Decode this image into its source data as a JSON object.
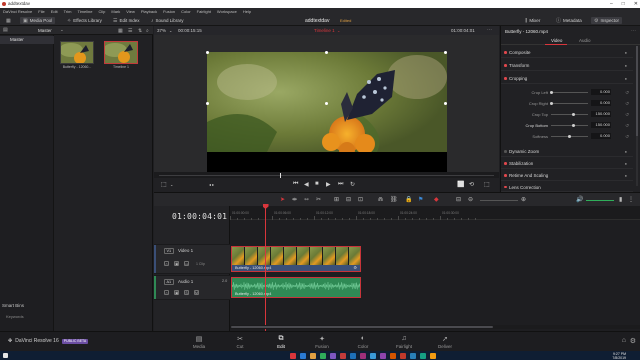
{
  "window": {
    "os_title": "addtextdav",
    "controls": [
      "–",
      "□",
      "✕"
    ]
  },
  "menu": [
    "DaVinci Resolve",
    "File",
    "Edit",
    "Trim",
    "Timeline",
    "Clip",
    "Mark",
    "View",
    "Playback",
    "Fusion",
    "Color",
    "Fairlight",
    "Workspace",
    "Help"
  ],
  "toolbar": {
    "media_pool": "Media Pool",
    "effects_library": "Effects Library",
    "edit_index": "Edit Index",
    "sound_library": "Sound Library",
    "project_name": "addtextdav",
    "project_status": "Edited",
    "mixer": "Mixer",
    "metadata": "Metadata",
    "inspector": "Inspector"
  },
  "media_pool": {
    "header_label": "Master",
    "bins": [
      "Master"
    ],
    "smart_bins": "Smart Bins",
    "keywords": "Keywords",
    "clips": [
      {
        "name": "Butterfly - 12060...",
        "selected": false
      },
      {
        "name": "Timeline 1",
        "selected": true
      }
    ]
  },
  "viewer": {
    "zoom": "37%",
    "timecode_left": "00:00:15:15",
    "timeline_name": "Timeline 1",
    "timecode_right": "01:00:04:01",
    "playback_position": 0.36
  },
  "inspector": {
    "title": "Butterfly - 12060.mp4",
    "tabs": [
      "Video",
      "Audio"
    ],
    "active_tab": "Video",
    "sections_top": [
      "Composite",
      "Transform",
      "Cropping"
    ],
    "crop_params": [
      {
        "label": "Crop Left",
        "value": "0.000",
        "bright": false,
        "level": 0.0
      },
      {
        "label": "Crop Right",
        "value": "0.000",
        "bright": false,
        "level": 0.0
      },
      {
        "label": "Crop Top",
        "value": "150.000",
        "bright": false,
        "level": 0.62
      },
      {
        "label": "Crop Bottom",
        "value": "150.000",
        "bright": true,
        "level": 0.62
      },
      {
        "label": "Softness",
        "value": "0.000",
        "bright": false,
        "level": 0.5
      }
    ],
    "sections_bottom": [
      "Dynamic Zoom",
      "Stabilization",
      "Retime And Scaling",
      "Lens Correction"
    ]
  },
  "timeline": {
    "timecode": "01:00:04:01",
    "ruler_ticks": [
      "01:00:00:00",
      "01:00:06:00",
      "01:00:12:00",
      "01:00:18:00",
      "01:00:24:00",
      "01:00:30:00"
    ],
    "tracks": [
      {
        "id": "V1",
        "name": "Video 1",
        "clip_count": "1 Clip",
        "clip_label": "Butterfly - 12060.mp4"
      },
      {
        "id": "A1",
        "name": "Audio 1",
        "level": "2.0",
        "clip_label": "Butterfly - 12060.mp4"
      }
    ],
    "audio_buttons": [
      "S",
      "M"
    ]
  },
  "pages": [
    {
      "label": "Media",
      "icon": "▤"
    },
    {
      "label": "Cut",
      "icon": "✂"
    },
    {
      "label": "Edit",
      "icon": "⧉"
    },
    {
      "label": "Fusion",
      "icon": "✦"
    },
    {
      "label": "Color",
      "icon": "◐"
    },
    {
      "label": "Fairlight",
      "icon": "♫"
    },
    {
      "label": "Deliver",
      "icon": "➚"
    }
  ],
  "active_page": "Edit",
  "branding": {
    "app": "DaVinci Resolve 16",
    "badge": "PUBLIC BETA"
  },
  "taskbar": {
    "time": "9:27 PM",
    "date": "7/8/2019"
  },
  "colors": {
    "accent_red": "#d9363c",
    "video_clip": "#3a4f77",
    "audio_clip": "#2f8a55",
    "status_orange": "#e0a043"
  }
}
